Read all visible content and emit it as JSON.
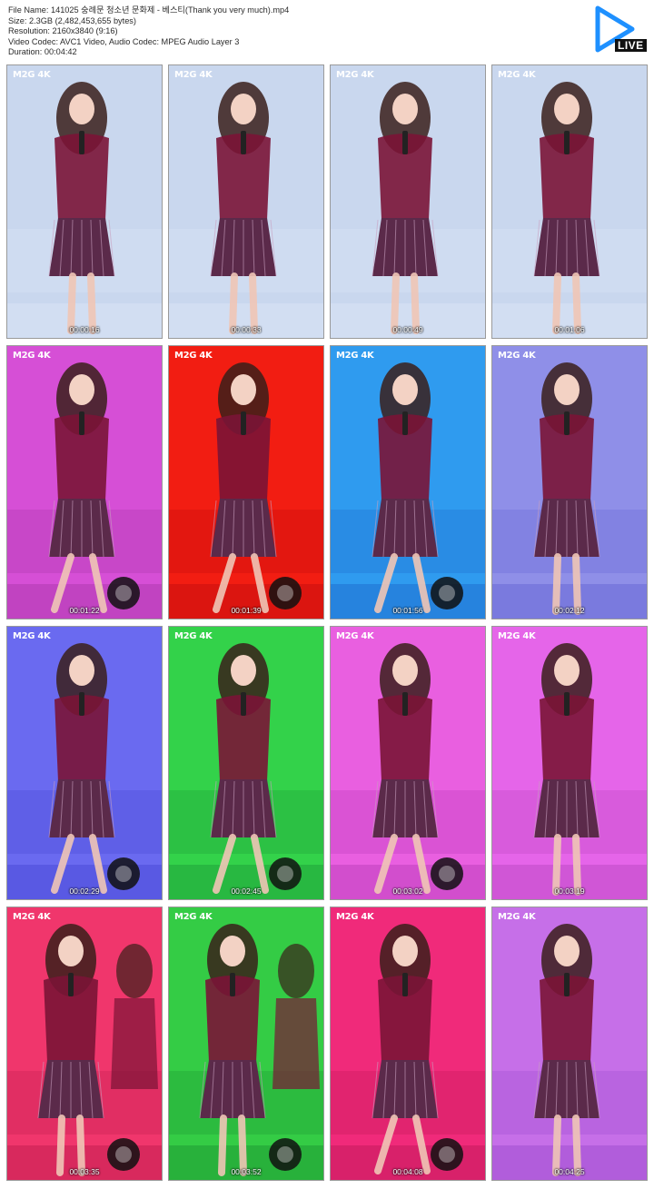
{
  "file_info": {
    "name_line": "File Name: 141025 숭례문 청소년 문화제 - 베스티(Thank you very much).mp4",
    "size_line": "Size: 2.3GB (2,482,453,655 bytes)",
    "resolution_line": "Resolution: 2160x3840 (9:16)",
    "codec_line": "Video Codec: AVC1 Video, Audio Codec: MPEG Audio Layer 3",
    "duration_line": "Duration: 00:04:42"
  },
  "badge": {
    "label": "LIVE",
    "icon": "play-triangle-icon",
    "color": "#1e90ff"
  },
  "watermark": "M2G 4K",
  "thumbnails": [
    {
      "timecode": "00:00:16",
      "bg": "#c9d7ee",
      "tint": "#d9e4f5",
      "pose": "stand"
    },
    {
      "timecode": "00:00:33",
      "bg": "#c9d7ee",
      "tint": "#d9e4f5",
      "pose": "stand"
    },
    {
      "timecode": "00:00:49",
      "bg": "#c9d7ee",
      "tint": "#d9e4f5",
      "pose": "stand"
    },
    {
      "timecode": "00:01:06",
      "bg": "#c9d7ee",
      "tint": "#d9e4f5",
      "pose": "stand"
    },
    {
      "timecode": "00:01:22",
      "bg": "#d64fd6",
      "tint": "#b03ab0",
      "pose": "dance"
    },
    {
      "timecode": "00:01:39",
      "bg": "#f21d12",
      "tint": "#c80f0f",
      "pose": "dance"
    },
    {
      "timecode": "00:01:56",
      "bg": "#2f9bef",
      "tint": "#1f6fd0",
      "pose": "dance"
    },
    {
      "timecode": "00:02:12",
      "bg": "#8f8fe8",
      "tint": "#6a6ad6",
      "pose": "stand"
    },
    {
      "timecode": "00:02:29",
      "bg": "#6a6af0",
      "tint": "#4b4bd8",
      "pose": "dance"
    },
    {
      "timecode": "00:02:45",
      "bg": "#33d24a",
      "tint": "#1fa23a",
      "pose": "dance"
    },
    {
      "timecode": "00:03:02",
      "bg": "#e95fe0",
      "tint": "#c03fbd",
      "pose": "dance"
    },
    {
      "timecode": "00:03:19",
      "bg": "#e565e9",
      "tint": "#c04bc6",
      "pose": "stand"
    },
    {
      "timecode": "00:03:35",
      "bg": "#f0366c",
      "tint": "#c51f52",
      "pose": "group"
    },
    {
      "timecode": "00:03:52",
      "bg": "#34cc45",
      "tint": "#1f9b33",
      "pose": "group"
    },
    {
      "timecode": "00:04:08",
      "bg": "#f02a7a",
      "tint": "#c51a5c",
      "pose": "dance"
    },
    {
      "timecode": "00:04:25",
      "bg": "#c66fe8",
      "tint": "#a04fd0",
      "pose": "stand"
    }
  ]
}
